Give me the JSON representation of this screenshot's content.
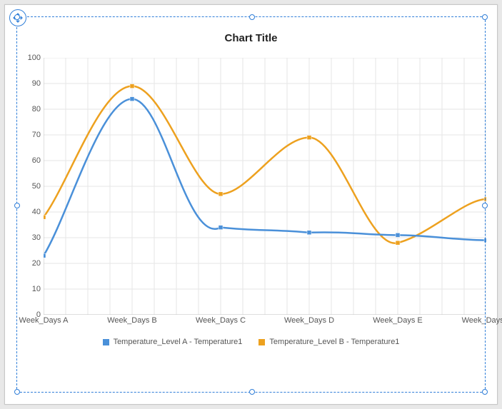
{
  "title": "Chart Title",
  "legend": {
    "series_a": "Temperature_Level A - Temperature1",
    "series_b": "Temperature_Level B - Temperature1"
  },
  "y_ticks": [
    "0",
    "10",
    "20",
    "30",
    "40",
    "50",
    "60",
    "70",
    "80",
    "90",
    "100"
  ],
  "x_ticks": [
    "Week_Days A",
    "Week_Days B",
    "Week_Days C",
    "Week_Days D",
    "Week_Days E",
    "Week_Days F"
  ],
  "chart_data": {
    "type": "line",
    "title": "Chart Title",
    "xlabel": "",
    "ylabel": "",
    "ylim": [
      0,
      100
    ],
    "categories": [
      "Week_Days A",
      "Week_Days B",
      "Week_Days C",
      "Week_Days D",
      "Week_Days E",
      "Week_Days F"
    ],
    "series": [
      {
        "name": "Temperature_Level A - Temperature1",
        "values": [
          23,
          84,
          34,
          32,
          31,
          29
        ],
        "color": "#4a90d9"
      },
      {
        "name": "Temperature_Level B - Temperature1",
        "values": [
          38,
          89,
          47,
          69,
          28,
          45
        ],
        "color": "#eda11f"
      }
    ],
    "legend_position": "bottom",
    "grid": true
  }
}
